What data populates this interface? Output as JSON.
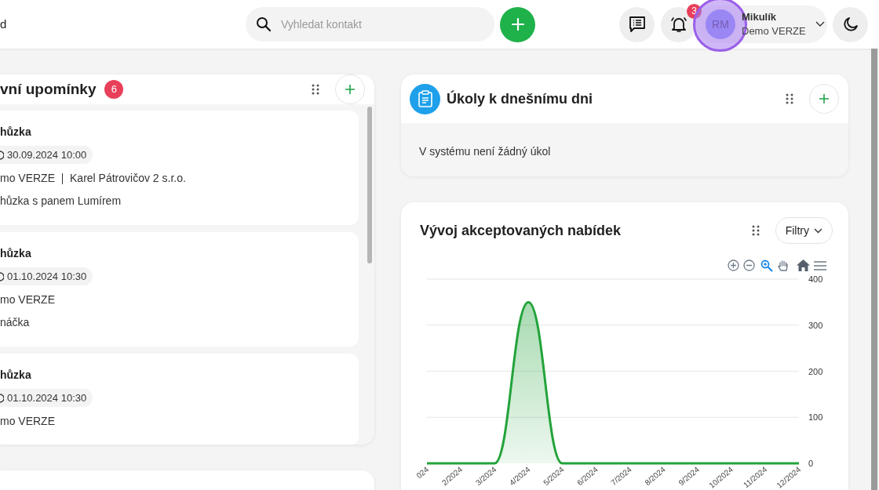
{
  "header": {
    "brand_fragment": "d",
    "search": {
      "placeholder": "Vyhledat kontakt"
    },
    "notifications": {
      "count": "3"
    },
    "user": {
      "initials": "RM",
      "name": "Mikulík",
      "company": "Demo VERZE"
    }
  },
  "reminders": {
    "title": "vní upomínky",
    "count": "6",
    "items": [
      {
        "title": "hůzka",
        "datetime": "30.09.2024 10:00",
        "company": "mo VERZE",
        "contact": "Karel Pátrovičov 2 s.r.o.",
        "note": "hůzka s panem Lumírem"
      },
      {
        "title": "hůzka",
        "datetime": "01.10.2024 10:30",
        "company": "mo VERZE",
        "note": "náčka"
      },
      {
        "title": "hůzka",
        "datetime": "01.10.2024 10:30",
        "company": "mo VERZE"
      }
    ]
  },
  "tasks": {
    "title": "Úkoly k dnešnímu dni",
    "empty_text": "V systému není žádný úkol"
  },
  "offers": {
    "title": "Vývoj akceptovaných nabídek",
    "filter_label": "Filtry",
    "chart_data": {
      "type": "area",
      "categories": [
        "024",
        "2/2024",
        "3/2024",
        "4/2024",
        "5/2024",
        "6/2024",
        "7/2024",
        "8/2024",
        "9/2024",
        "10/2024",
        "11/2024",
        "12/2024"
      ],
      "series": [
        {
          "color": "#22a33a",
          "values": [
            0,
            0,
            0,
            350,
            0,
            0,
            0,
            0,
            0,
            0,
            0,
            0
          ]
        }
      ],
      "ylim": [
        0,
        400
      ],
      "grid": true,
      "yticks": [
        0,
        100,
        200,
        300,
        400
      ]
    }
  }
}
